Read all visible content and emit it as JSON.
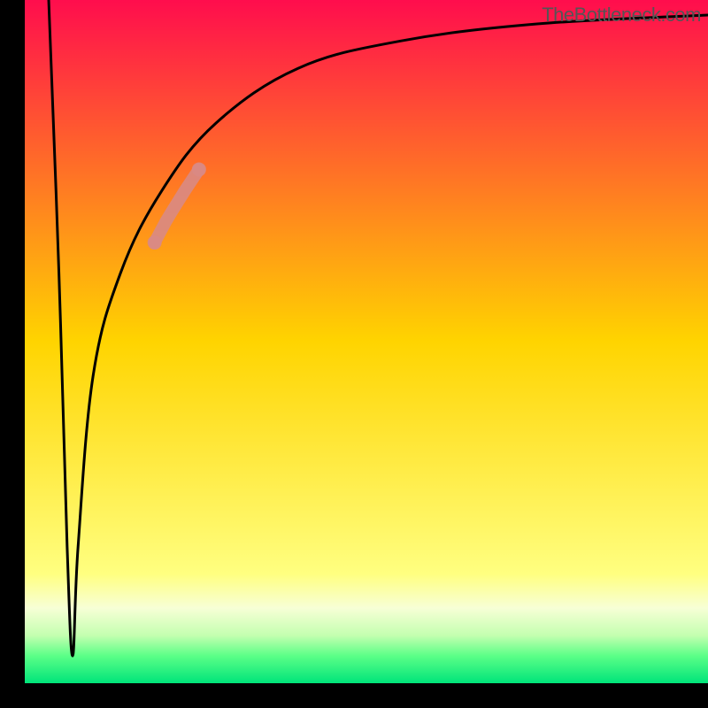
{
  "attribution": "TheBottleneck.com",
  "chart_data": {
    "type": "line",
    "title": "",
    "xlabel": "",
    "ylabel": "",
    "xlim": [
      0,
      100
    ],
    "ylim": [
      0,
      100
    ],
    "background_gradient": {
      "stops": [
        {
          "pct": 0,
          "color": "#ff0d4d"
        },
        {
          "pct": 50,
          "color": "#ffd400"
        },
        {
          "pct": 84,
          "color": "#ffff80"
        },
        {
          "pct": 89,
          "color": "#f7ffd6"
        },
        {
          "pct": 93,
          "color": "#c4ffb0"
        },
        {
          "pct": 96,
          "color": "#5bff87"
        },
        {
          "pct": 100,
          "color": "#00e47a"
        }
      ]
    },
    "series": [
      {
        "name": "bottleneck-curve",
        "type": "line",
        "color": "#000000",
        "points": [
          {
            "x": 3.5,
            "y": 100
          },
          {
            "x": 5.0,
            "y": 60
          },
          {
            "x": 6.2,
            "y": 20
          },
          {
            "x": 7.0,
            "y": 4
          },
          {
            "x": 7.8,
            "y": 20
          },
          {
            "x": 10.0,
            "y": 45
          },
          {
            "x": 14.0,
            "y": 60
          },
          {
            "x": 20.0,
            "y": 72
          },
          {
            "x": 28.0,
            "y": 82
          },
          {
            "x": 40.0,
            "y": 90
          },
          {
            "x": 55.0,
            "y": 94
          },
          {
            "x": 75.0,
            "y": 96.5
          },
          {
            "x": 100.0,
            "y": 97.8
          }
        ]
      },
      {
        "name": "highlight-band",
        "type": "scatter",
        "color": "#d98a84",
        "points": [
          {
            "x": 19.0,
            "y": 64.5
          },
          {
            "x": 19.8,
            "y": 66.0
          },
          {
            "x": 20.6,
            "y": 67.5
          },
          {
            "x": 21.5,
            "y": 69.0
          },
          {
            "x": 22.5,
            "y": 70.6
          },
          {
            "x": 23.5,
            "y": 72.2
          },
          {
            "x": 24.5,
            "y": 73.7
          },
          {
            "x": 25.5,
            "y": 75.2
          }
        ]
      }
    ]
  }
}
